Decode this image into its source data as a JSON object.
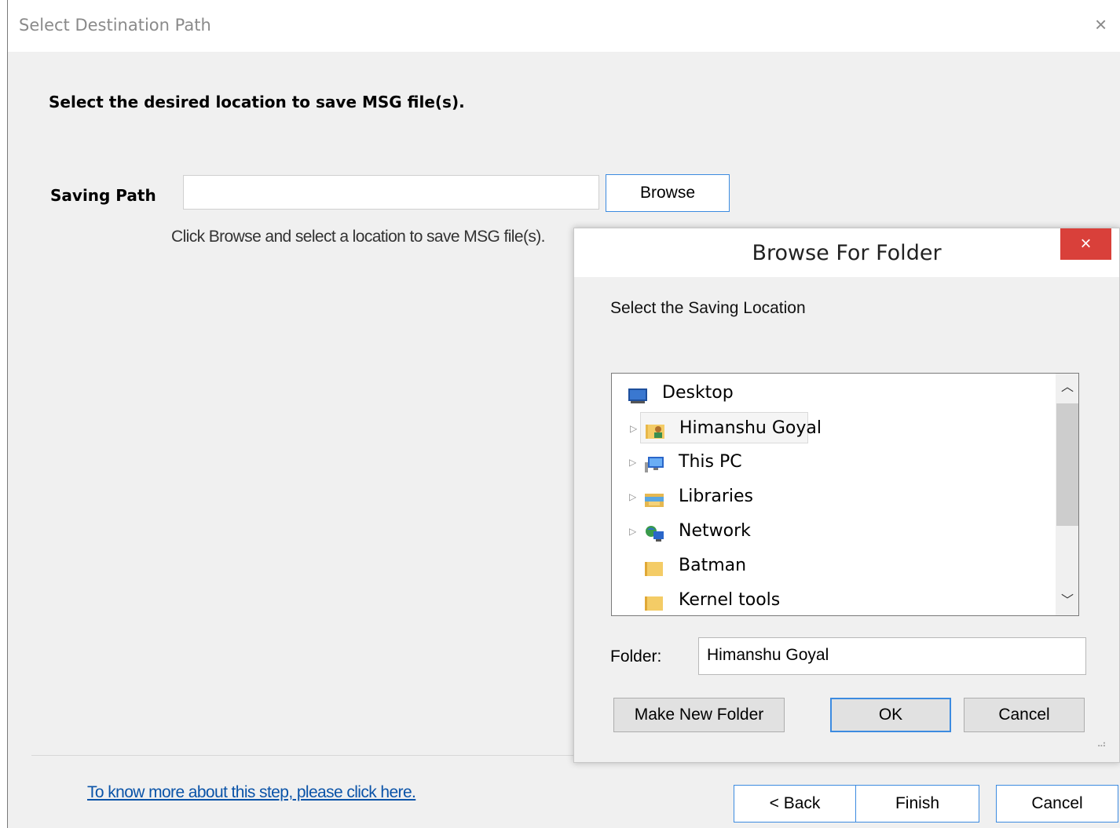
{
  "wizard": {
    "title": "Select Destination Path",
    "close_glyph": "×",
    "instruction": "Select the desired location to save MSG file(s).",
    "saving_path": {
      "label": "Saving Path",
      "value": "",
      "placeholder": ""
    },
    "browse_button": "Browse",
    "hint": "Click Browse and select a location to save MSG file(s).",
    "help_link": "To know more about this step, please click here.",
    "buttons": {
      "back": "< Back",
      "finish": "Finish",
      "cancel": "Cancel"
    }
  },
  "browse_dialog": {
    "title": "Browse For Folder",
    "close_glyph": "×",
    "description": "Select the Saving Location",
    "tree": [
      {
        "label": "Desktop",
        "icon": "desktop-icon",
        "expandable": false,
        "selected": false
      },
      {
        "label": "Himanshu Goyal",
        "icon": "user-folder-icon",
        "expandable": true,
        "selected": true
      },
      {
        "label": "This PC",
        "icon": "computer-icon",
        "expandable": true,
        "selected": false
      },
      {
        "label": "Libraries",
        "icon": "libraries-icon",
        "expandable": true,
        "selected": false
      },
      {
        "label": "Network",
        "icon": "network-icon",
        "expandable": true,
        "selected": false
      },
      {
        "label": "Batman",
        "icon": "folder-icon",
        "expandable": false,
        "selected": false
      },
      {
        "label": "Kernel tools",
        "icon": "folder-icon",
        "expandable": false,
        "selected": false
      }
    ],
    "folder_label": "Folder:",
    "folder_value": "Himanshu Goyal",
    "buttons": {
      "make_new_folder": "Make New Folder",
      "ok": "OK",
      "cancel": "Cancel"
    }
  },
  "colors": {
    "accent_border": "#3c8be0",
    "link": "#0a53a8",
    "close_red": "#d9403a",
    "dialog_bg": "#f0f0f0"
  }
}
